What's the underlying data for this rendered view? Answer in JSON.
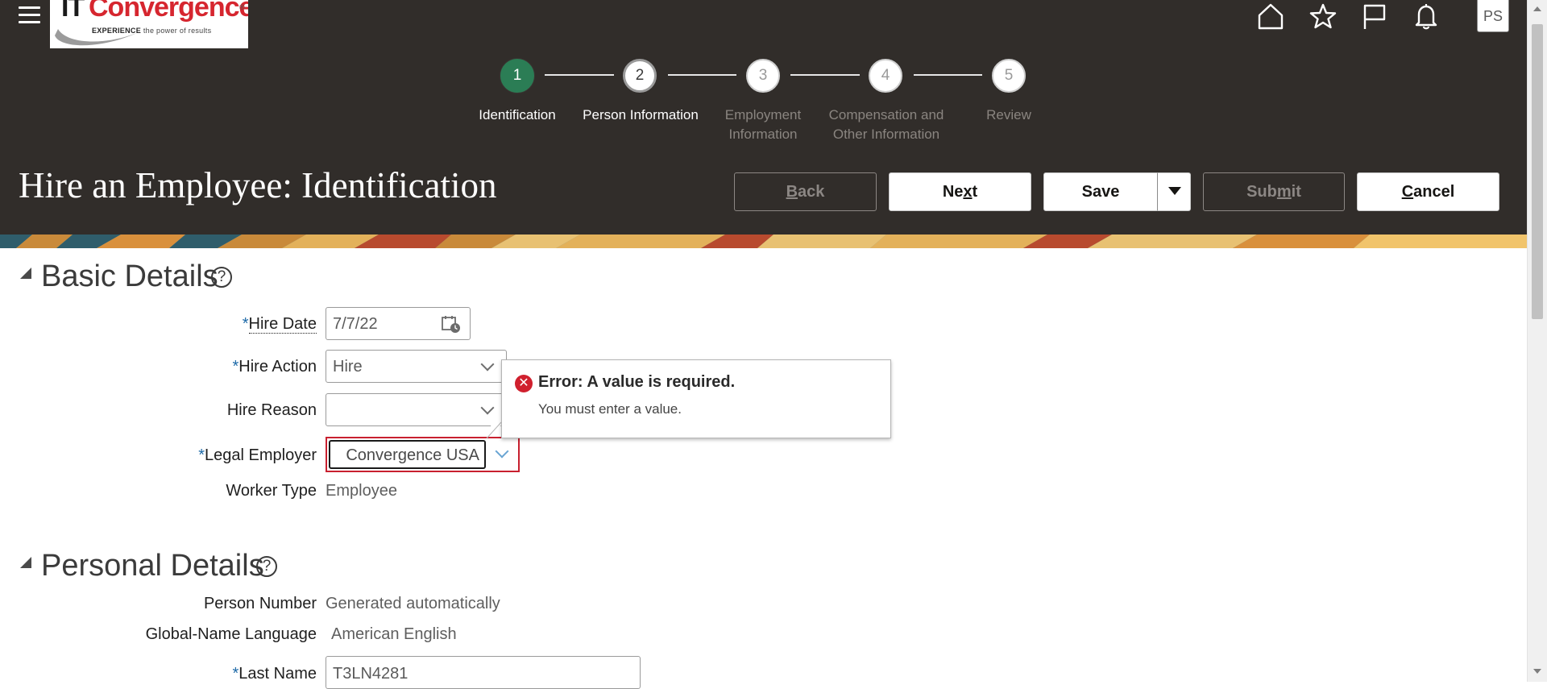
{
  "header": {
    "logo": {
      "brand_it": "IT",
      "brand_name": "Convergence",
      "trademark": "®",
      "tagline_bold": "EXPERIENCE",
      "tagline": "the power of results"
    },
    "icons": [
      "menu-icon",
      "home-icon",
      "star-icon",
      "flag-icon",
      "bell-icon"
    ],
    "user_initials": "PS",
    "page_title": "Hire an Employee: Identification"
  },
  "train": {
    "stops": [
      {
        "number": "1",
        "label_line1": "Identification",
        "label_line2": "",
        "state": "current"
      },
      {
        "number": "2",
        "label_line1": "Person Information",
        "label_line2": "",
        "state": "visited"
      },
      {
        "number": "3",
        "label_line1": "Employment",
        "label_line2": "Information",
        "state": "future"
      },
      {
        "number": "4",
        "label_line1": "Compensation and",
        "label_line2": "Other Information",
        "state": "future"
      },
      {
        "number": "5",
        "label_line1": "Review",
        "label_line2": "",
        "state": "future"
      }
    ]
  },
  "buttons": {
    "back": {
      "mnemonic": "B",
      "rest": "ack",
      "enabled": false
    },
    "next": {
      "before": "Ne",
      "mnemonic": "x",
      "rest": "t",
      "enabled": true
    },
    "save": {
      "label": "Save",
      "enabled": true
    },
    "submit": {
      "before": "Sub",
      "mnemonic": "m",
      "rest": "it",
      "enabled": false
    },
    "cancel": {
      "mnemonic": "C",
      "rest": "ancel",
      "enabled": true
    }
  },
  "basic_details": {
    "title": "Basic Details",
    "help_glyph": "?",
    "hire_date": {
      "label": "Hire Date",
      "value": "7/7/22",
      "required": true
    },
    "hire_action": {
      "label": "Hire Action",
      "value": "Hire",
      "required": true
    },
    "hire_reason": {
      "label": "Hire Reason",
      "value": "",
      "required": false
    },
    "legal_employer": {
      "label": "Legal Employer",
      "value": "Convergence USA",
      "required": true
    },
    "worker_type": {
      "label": "Worker Type",
      "value": "Employee"
    }
  },
  "error_popup": {
    "title": "Error: A value is required.",
    "message": "You must enter a value.",
    "icon_glyph": "✕"
  },
  "personal_details": {
    "title": "Personal Details",
    "help_glyph": "?",
    "person_number": {
      "label": "Person Number",
      "value": "Generated automatically"
    },
    "global_name_language": {
      "label": "Global-Name Language",
      "value": "American English"
    },
    "last_name": {
      "label": "Last Name",
      "value": "T3LN4281",
      "required": true
    }
  },
  "colors": {
    "header_bg": "#312d2a",
    "current_stop": "#2b7d55",
    "error_red": "#c8202f",
    "required_star": "#1e6aa8"
  }
}
